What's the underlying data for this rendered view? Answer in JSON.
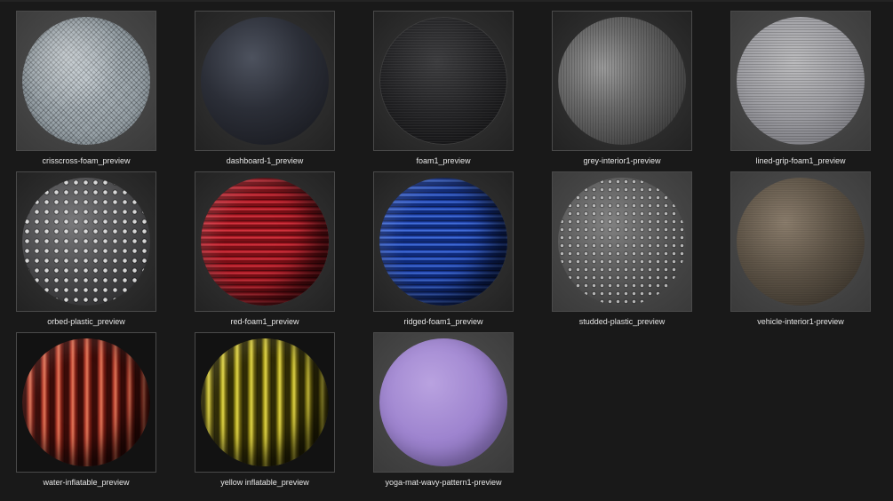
{
  "files": [
    {
      "name": "crisscross-foam_preview"
    },
    {
      "name": "dashboard-1_preview"
    },
    {
      "name": "foam1_preview"
    },
    {
      "name": "grey-interior1-preview"
    },
    {
      "name": "lined-grip-foam1_preview"
    },
    {
      "name": "orbed-plastic_preview"
    },
    {
      "name": "red-foam1_preview"
    },
    {
      "name": "ridged-foam1_preview"
    },
    {
      "name": "studded-plastic_preview"
    },
    {
      "name": "vehicle-interior1-preview"
    },
    {
      "name": "water-inflatable_preview"
    },
    {
      "name": "yellow inflatable_preview"
    },
    {
      "name": "yoga-mat-wavy-pattern1-preview"
    }
  ]
}
